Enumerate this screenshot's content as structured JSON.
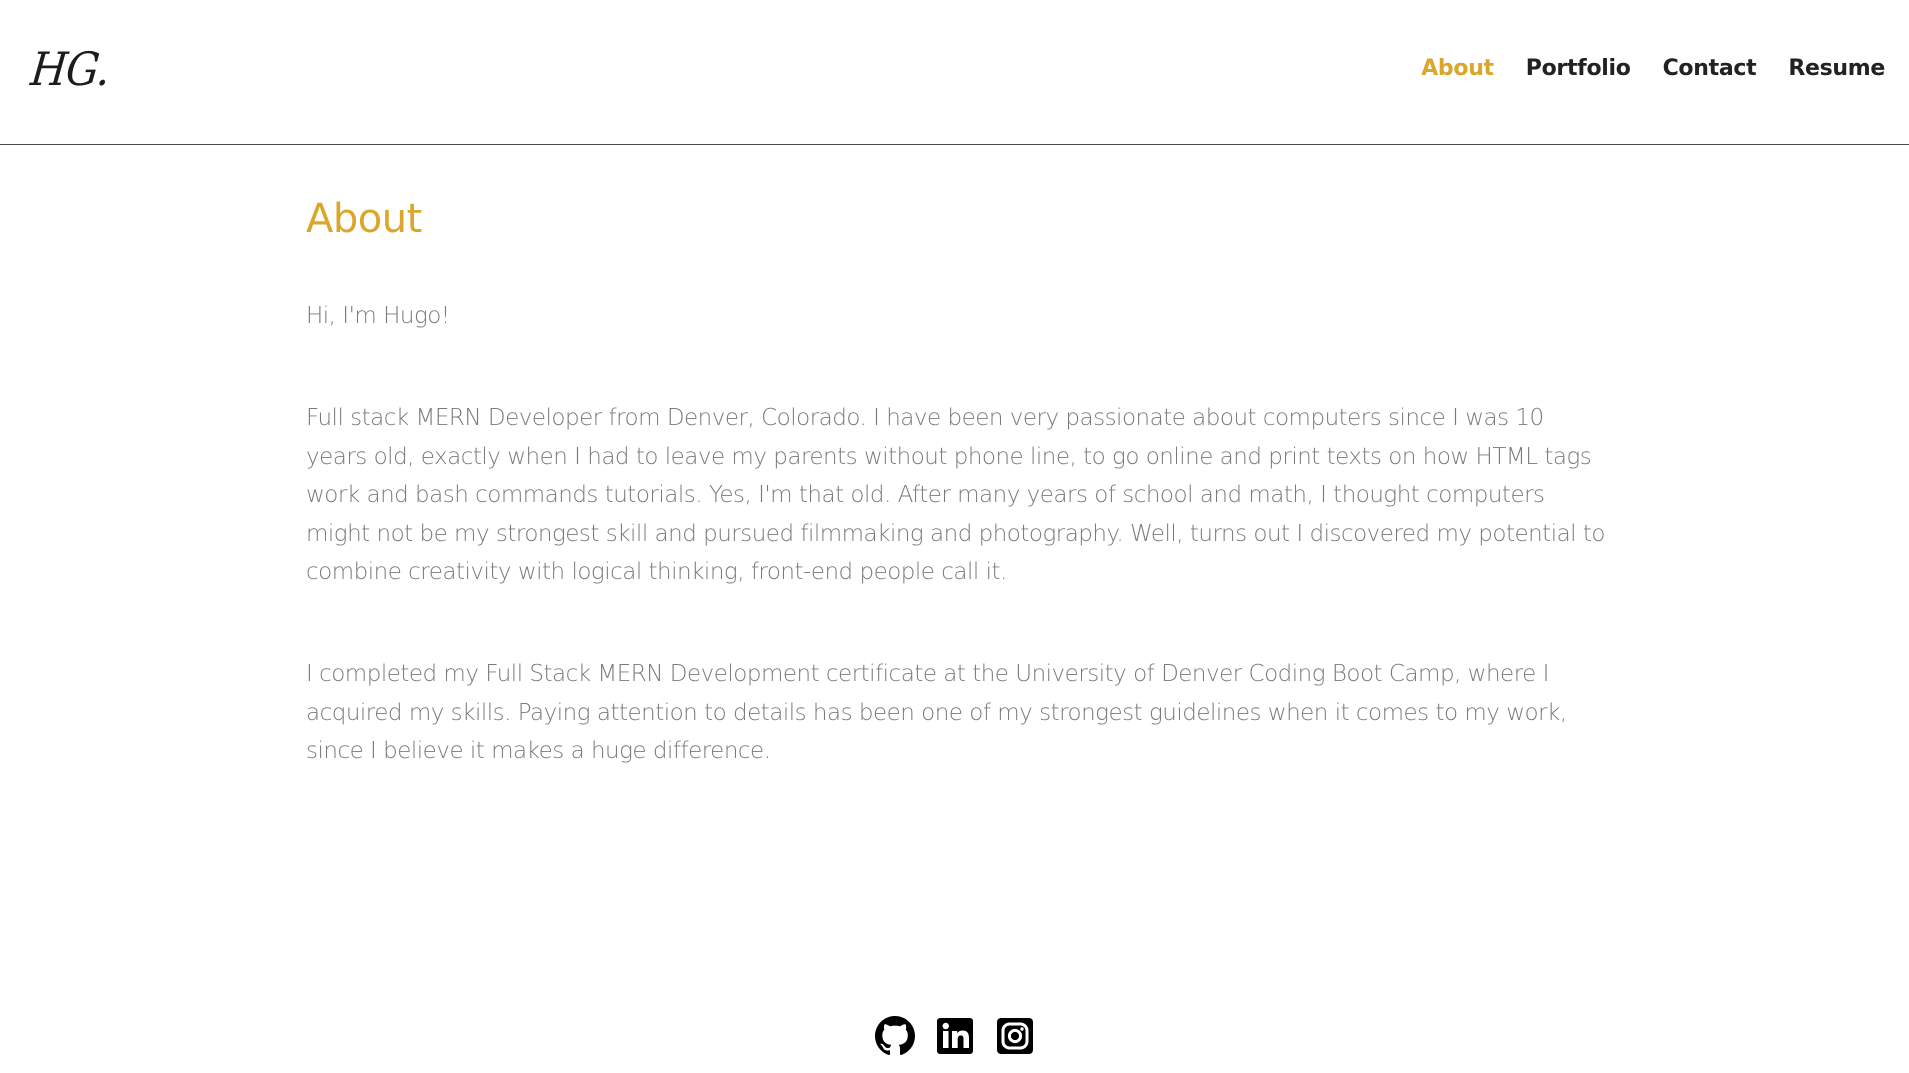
{
  "header": {
    "logo": "HG.",
    "nav": [
      {
        "label": "About",
        "active": true
      },
      {
        "label": "Portfolio",
        "active": false
      },
      {
        "label": "Contact",
        "active": false
      },
      {
        "label": "Resume",
        "active": false
      }
    ]
  },
  "main": {
    "title": "About",
    "greeting": "Hi, I'm Hugo!",
    "intro": "Full stack MERN Developer from Denver, Colorado. I have been very passionate about computers since I was 10 years old, exactly when I had to leave my parents without phone line, to go online and print texts on how HTML tags work and bash commands tutorials. Yes, I'm that old. After many years of school and math, I thought computers might not be my strongest skill and pursued filmmaking and photography. Well, turns out I discovered my potential to combine creativity with logical thinking, front-end people call it.",
    "education": "I completed my Full Stack MERN Development certificate at the University of Denver Coding Boot Camp, where I acquired my skills. Paying attention to details has been one of my strongest guidelines when it comes to my work, since I believe it makes a huge difference."
  },
  "footer": {
    "icons": [
      "github-icon",
      "linkedin-icon",
      "instagram-icon"
    ]
  },
  "colors": {
    "accent": "#dba72a",
    "text": "#7a7a7a",
    "nav_text": "#222222"
  }
}
